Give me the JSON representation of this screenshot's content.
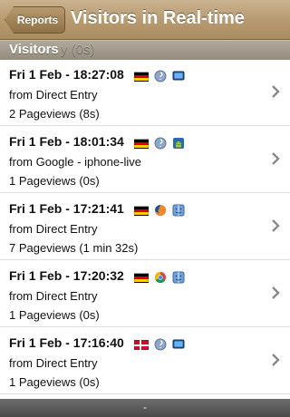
{
  "nav": {
    "back_label": "Reports",
    "title": "Visitors in Real-time"
  },
  "section": {
    "title": "Visitors",
    "ghost_text": "y (0s)"
  },
  "visitors": [
    {
      "datetime": "Fri 1 Feb - 18:27:08",
      "source": "from Direct Entry",
      "pageviews": "2 Pageviews (8s)",
      "icons": [
        "flag-de",
        "browser-unknown-icon",
        "os-desktop-icon"
      ]
    },
    {
      "datetime": "Fri 1 Feb - 18:01:34",
      "source": "from Google - iphone-live",
      "pageviews": "1 Pageviews (0s)",
      "icons": [
        "flag-de",
        "browser-unknown-icon",
        "android-icon"
      ]
    },
    {
      "datetime": "Fri 1 Feb - 17:21:41",
      "source": "from Direct Entry",
      "pageviews": "7 Pageviews (1 min 32s)",
      "icons": [
        "flag-de",
        "firefox-icon",
        "mac-finder-icon"
      ]
    },
    {
      "datetime": "Fri 1 Feb - 17:20:32",
      "source": "from Direct Entry",
      "pageviews": "1 Pageviews (0s)",
      "icons": [
        "flag-de",
        "chrome-icon",
        "mac-finder-icon"
      ]
    },
    {
      "datetime": "Fri 1 Feb - 17:16:40",
      "source": "from Direct Entry",
      "pageviews": "1 Pageviews (0s)",
      "icons": [
        "flag-dk",
        "browser-unknown-icon",
        "os-desktop-icon"
      ]
    }
  ],
  "bottom_bar": {
    "label": "-"
  },
  "colors": {
    "navbar": "#b89c71",
    "section_header": "#a39a8c"
  }
}
